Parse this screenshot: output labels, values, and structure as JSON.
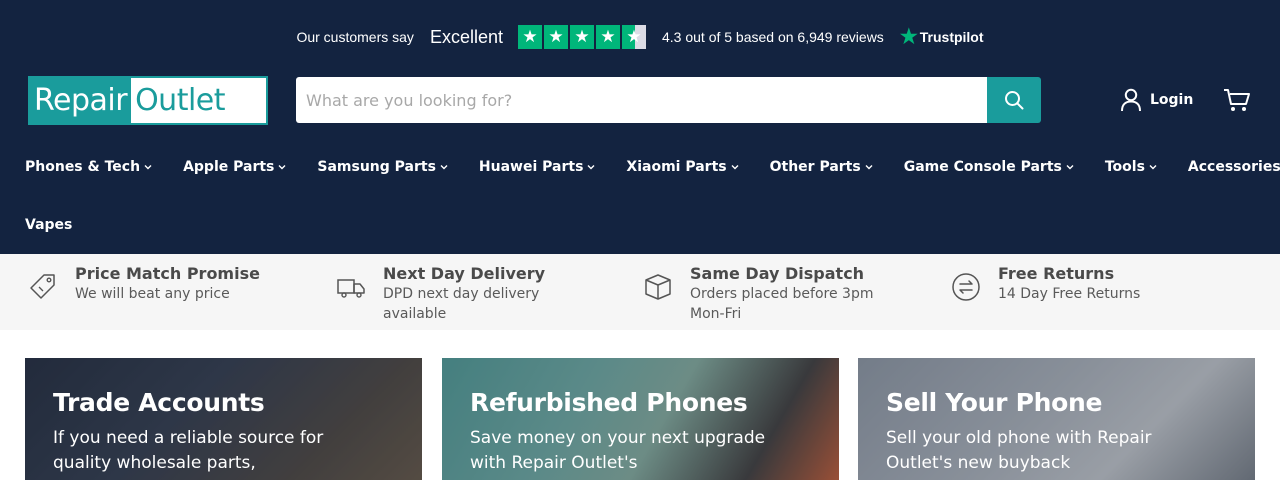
{
  "trustpilot": {
    "customers_say": "Our customers say",
    "verdict": "Excellent",
    "rating_text": "4.3 out of 5 based on 6,949 reviews",
    "brand": "Trustpilot",
    "star_glyph": "★",
    "stars_rating": 4.3,
    "stars_max": 5,
    "star_color": "#00b67a"
  },
  "logo": {
    "part1": "Repair",
    "part2": "Outlet",
    "brand_color": "#1a9c9c"
  },
  "search": {
    "placeholder": "What are you looking for?",
    "value": "",
    "icon": "search-icon"
  },
  "account": {
    "login_label": "Login",
    "user_icon": "user-icon",
    "cart_icon": "cart-icon"
  },
  "nav": {
    "row1": [
      {
        "label": "Phones & Tech"
      },
      {
        "label": "Apple Parts"
      },
      {
        "label": "Samsung Parts"
      },
      {
        "label": "Huawei Parts"
      },
      {
        "label": "Xiaomi Parts"
      },
      {
        "label": "Other Parts"
      },
      {
        "label": "Game Console Parts"
      },
      {
        "label": "Tools"
      },
      {
        "label": "Accessories"
      }
    ],
    "row2": [
      {
        "label": "Vapes"
      }
    ]
  },
  "promises": [
    {
      "title": "Price Match Promise",
      "sub": "We will beat any price",
      "icon": "price-tag-icon"
    },
    {
      "title": "Next Day Delivery",
      "sub": "DPD next day delivery available",
      "icon": "delivery-truck-icon"
    },
    {
      "title": "Same Day Dispatch",
      "sub": "Orders placed before 3pm Mon-Fri",
      "icon": "box-icon"
    },
    {
      "title": "Free Returns",
      "sub": "14 Day Free Returns",
      "icon": "returns-icon"
    }
  ],
  "cards": [
    {
      "title": "Trade Accounts",
      "text": "If you need a reliable source for quality wholesale parts,"
    },
    {
      "title": "Refurbished Phones",
      "text": "Save money on your next upgrade with Repair Outlet's"
    },
    {
      "title": "Sell Your Phone",
      "text": "Sell your old phone with Repair Outlet's new buyback"
    }
  ],
  "colors": {
    "header_bg": "#132340",
    "accent": "#1a9c9c",
    "promise_bg": "#f6f6f6"
  }
}
